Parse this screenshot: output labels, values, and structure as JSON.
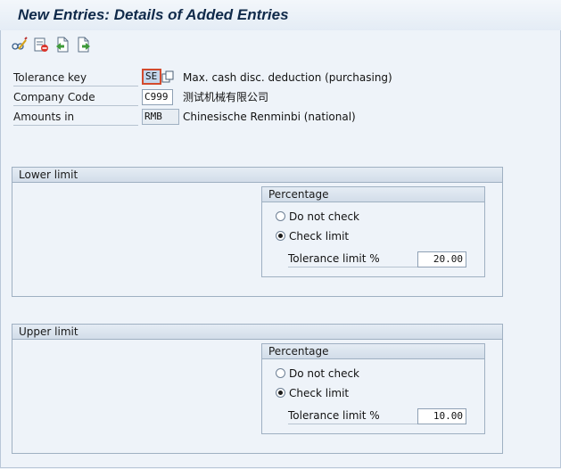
{
  "title": "New Entries: Details of Added Entries",
  "toolbar": {
    "icons": [
      "display-change-icon",
      "delete-icon",
      "previous-entry-icon",
      "next-entry-icon"
    ]
  },
  "fields": {
    "tolerance_key": {
      "label": "Tolerance key",
      "value": "SE",
      "description": "Max. cash disc. deduction (purchasing)"
    },
    "company_code": {
      "label": "Company Code",
      "value": "C999",
      "description": "测试机械有限公司"
    },
    "amounts_in": {
      "label": "Amounts in",
      "value": "RMB",
      "description": "Chinesische Renminbi (national)"
    }
  },
  "lower_limit": {
    "title": "Lower limit",
    "percentage": {
      "title": "Percentage",
      "option_do_not_check": "Do not check",
      "option_check_limit": "Check limit",
      "selected": "Check limit",
      "tolerance_label": "Tolerance limit %",
      "tolerance_value": "20.00"
    }
  },
  "upper_limit": {
    "title": "Upper limit",
    "percentage": {
      "title": "Percentage",
      "option_do_not_check": "Do not check",
      "option_check_limit": "Check limit",
      "selected": "Check limit",
      "tolerance_label": "Tolerance limit %",
      "tolerance_value": "10.00"
    }
  },
  "colors": {
    "background": "#eef3f9",
    "title_text": "#102a4a",
    "focus_border": "#d34b2e"
  }
}
